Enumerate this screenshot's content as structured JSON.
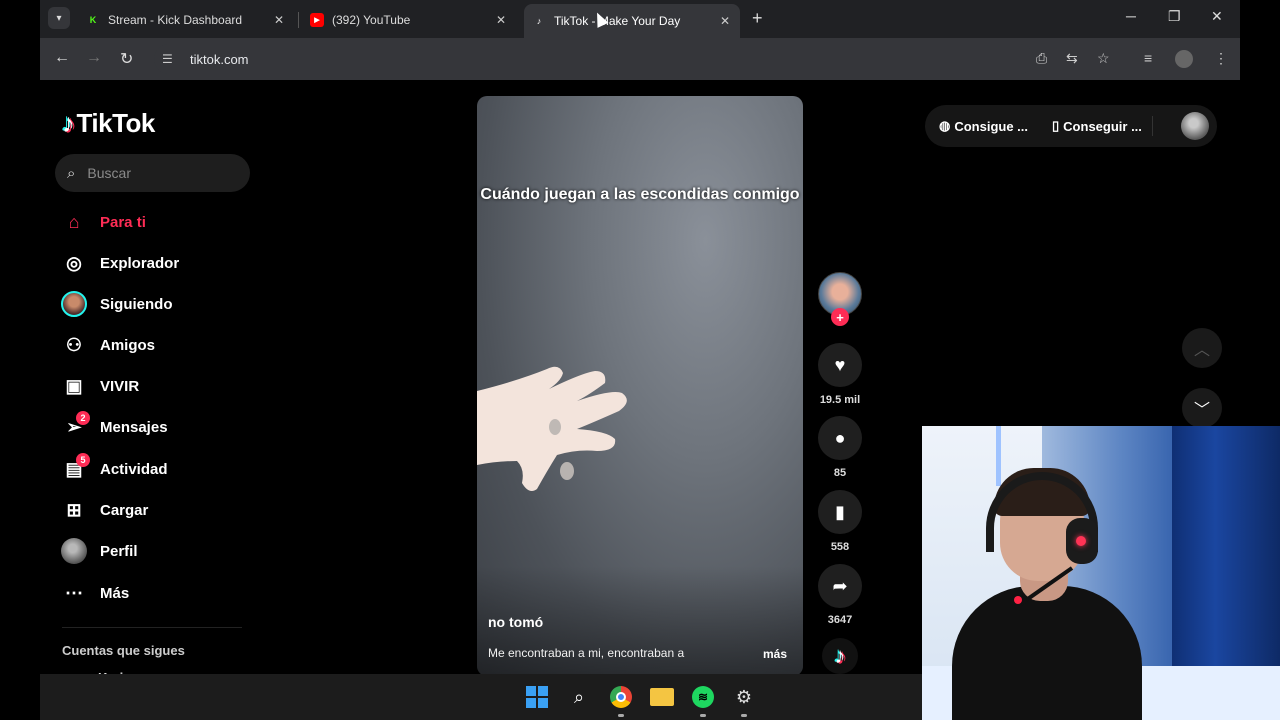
{
  "browser": {
    "tabs": [
      {
        "title": "Stream - Kick Dashboard",
        "favicon": "kick-icon",
        "color": "#53fc18"
      },
      {
        "title": "(392) YouTube",
        "favicon": "youtube-icon",
        "color": "#ff0000"
      },
      {
        "title": "TikTok - Make Your Day",
        "favicon": "tiktok-icon",
        "active": true
      }
    ],
    "url": "tiktok.com"
  },
  "sidebar": {
    "logo_text": "TikTok",
    "search_placeholder": "Buscar",
    "items": [
      {
        "label": "Para ti",
        "icon": "home-icon",
        "active": true
      },
      {
        "label": "Explorador",
        "icon": "compass-icon"
      },
      {
        "label": "Siguiendo",
        "icon": "following-avatar"
      },
      {
        "label": "Amigos",
        "icon": "friends-icon"
      },
      {
        "label": "VIVIR",
        "icon": "live-tv-icon"
      },
      {
        "label": "Mensajes",
        "icon": "messages-icon",
        "badge": "2"
      },
      {
        "label": "Actividad",
        "icon": "activity-icon",
        "badge": "5"
      },
      {
        "label": "Cargar",
        "icon": "upload-icon"
      },
      {
        "label": "Perfil",
        "icon": "profile-avatar"
      },
      {
        "label": "Más",
        "icon": "more-icon"
      }
    ],
    "following_title": "Cuentas que sigues",
    "following_first": "Karina"
  },
  "video": {
    "caption": "Cuándo juegan a las escondidas conmigo",
    "author": "no tomó",
    "description": "Me encontraban a mi, encontraban a",
    "more": "más"
  },
  "actions": {
    "likes": "19.5 mil",
    "comments": "85",
    "saves": "558",
    "shares": "3647"
  },
  "header": {
    "coins_label": "Consigue ...",
    "app_label": "Conseguir ..."
  },
  "colors": {
    "accent": "#fe2c55",
    "cyan": "#25f4ee"
  }
}
